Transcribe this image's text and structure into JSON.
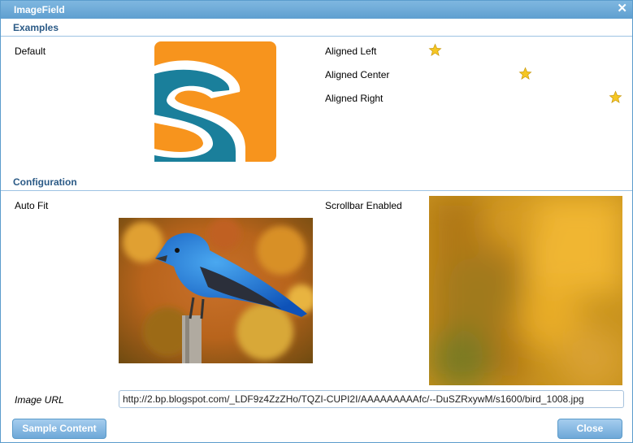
{
  "window": {
    "title": "ImageField"
  },
  "sections": {
    "examples": {
      "title": "Examples"
    },
    "configuration": {
      "title": "Configuration"
    }
  },
  "examples": {
    "default_label": "Default",
    "aligned_left_label": "Aligned Left",
    "aligned_center_label": "Aligned Center",
    "aligned_right_label": "Aligned Right"
  },
  "configuration": {
    "auto_fit_label": "Auto Fit",
    "scrollbar_enabled_label": "Scrollbar Enabled",
    "image_url_label": "Image URL",
    "image_url_value": "http://2.bp.blogspot.com/_LDF9z4ZzZHo/TQZI-CUPI2I/AAAAAAAAAfc/--DuSZRxywM/s1600/bird_1008.jpg"
  },
  "buttons": {
    "sample_content": "Sample Content",
    "close": "Close"
  },
  "icons": {
    "close": "close-icon",
    "star": "star-icon"
  },
  "colors": {
    "titlebar": "#6aa8d8",
    "section_title": "#2b5a86",
    "logo_orange": "#f7941d",
    "logo_teal": "#1a7f9b",
    "star": "#f5c623"
  }
}
